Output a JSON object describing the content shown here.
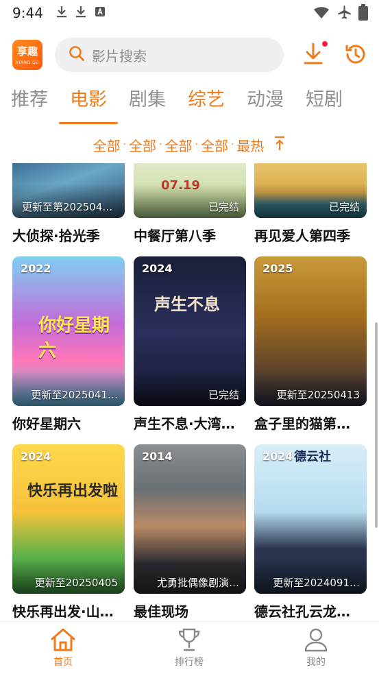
{
  "status_bar": {
    "time": "9:44"
  },
  "header": {
    "logo_text": "享趣",
    "logo_sub": "XIANG QU",
    "search_placeholder": "影片搜索"
  },
  "tabs": [
    {
      "label": "推荐"
    },
    {
      "label": "电影"
    },
    {
      "label": "剧集"
    },
    {
      "label": "综艺"
    },
    {
      "label": "动漫"
    },
    {
      "label": "短剧"
    }
  ],
  "filters": [
    "全部",
    "全部",
    "全部",
    "全部",
    "最热"
  ],
  "grid": [
    {
      "title": "大侦探·拾光季",
      "year": "",
      "status": "更新至第202504…"
    },
    {
      "title": "中餐厅第八季",
      "year": "",
      "status": "已完结",
      "poster_text": "07.19"
    },
    {
      "title": "再见爱人第四季",
      "year": "",
      "status": "已完结"
    },
    {
      "title": "你好星期六",
      "year": "2022",
      "status": "更新至2025041…",
      "poster_text": "你好星期六"
    },
    {
      "title": "声生不息·大湾…",
      "year": "2024",
      "status": "已完结",
      "poster_text": "声生不息"
    },
    {
      "title": "盒子里的猫第…",
      "year": "2025",
      "status": "更新至20250413"
    },
    {
      "title": "快乐再出发·山…",
      "year": "2024",
      "status": "更新至20250405",
      "poster_text": "快乐再出发啦"
    },
    {
      "title": "最佳现场",
      "year": "2014",
      "status": "尤勇批偶像剧演…"
    },
    {
      "title": "德云社孔云龙…",
      "year": "2024",
      "status": "更新至2024091…",
      "poster_text": "德云社"
    }
  ],
  "bottom_nav": [
    {
      "label": "首页"
    },
    {
      "label": "排行榜"
    },
    {
      "label": "我的"
    }
  ],
  "colors": {
    "accent": "#f07b1b",
    "notification": "#ff1e3c"
  }
}
